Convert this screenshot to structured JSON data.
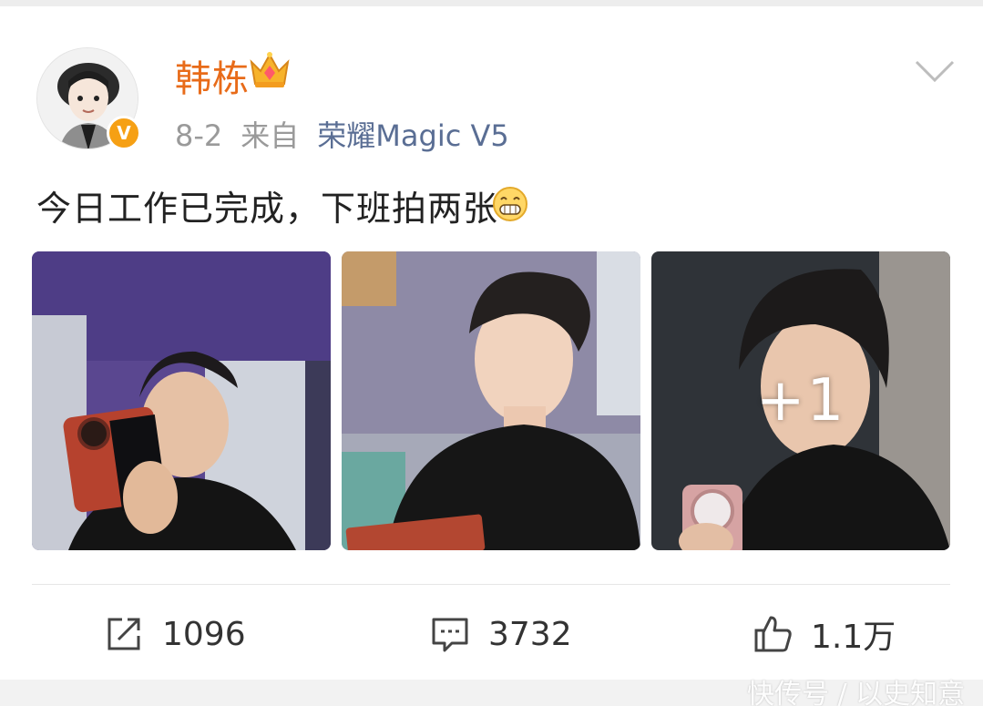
{
  "post": {
    "user": {
      "name": "韩栋",
      "verified_badge": "V",
      "crown_icon": "crown-icon",
      "avatar_icon": "avatar-icon"
    },
    "date": "8-2",
    "from_label": "来自",
    "source": "荣耀Magic V5",
    "text": "今日工作已完成，下班拍两张！",
    "emoji_icon": "grin-emoji-icon",
    "images": [
      {
        "name": "photo-1"
      },
      {
        "name": "photo-2"
      },
      {
        "name": "photo-3",
        "more_count": "+1"
      }
    ]
  },
  "actions": {
    "repost": {
      "icon": "repost-icon",
      "count": "1096"
    },
    "comment": {
      "icon": "comment-icon",
      "count": "3732"
    },
    "like": {
      "icon": "thumbs-up-icon",
      "count": "1.1万"
    }
  },
  "watermark": "快传号 / 以史知意",
  "colors": {
    "username": "#e86b19",
    "source_link": "#5a6e94",
    "meta_gray": "#9a9a9a",
    "badge": "#f6a014"
  }
}
